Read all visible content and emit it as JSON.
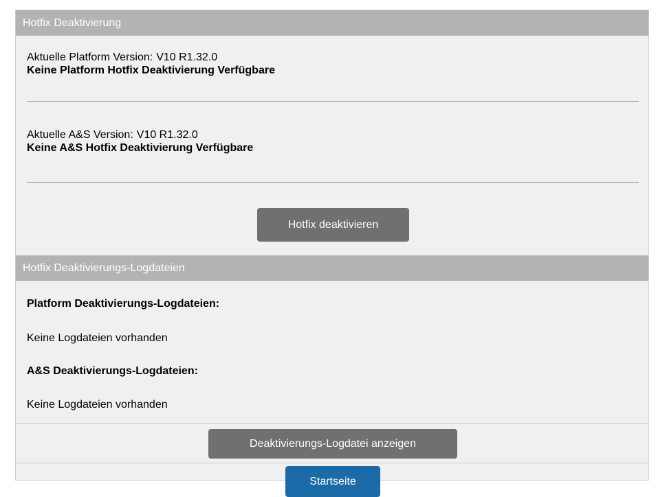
{
  "deactivation": {
    "header": "Hotfix Deaktivierung",
    "platform_label": "Aktuelle Platform Version:",
    "platform_version": "V10 R1.32.0",
    "platform_status": "Keine Platform Hotfix Deaktivierung Verfügbare",
    "as_label": "Aktuelle A&S Version:",
    "as_version": "V10 R1.32.0",
    "as_status": "Keine A&S Hotfix Deaktivierung Verfügbare",
    "deactivate_button": "Hotfix deaktivieren"
  },
  "logs": {
    "header": "Hotfix Deaktivierungs-Logdateien",
    "platform_title": "Platform Deaktivierungs-Logdateien:",
    "platform_empty": "Keine Logdateien vorhanden",
    "as_title": "A&S Deaktivierungs-Logdateien:",
    "as_empty": "Keine Logdateien vorhanden",
    "show_button": "Deaktivierungs-Logdatei anzeigen"
  },
  "footer": {
    "home_button": "Startseite"
  },
  "colors": {
    "header_bg": "#b3b3b3",
    "panel_bg": "#f0f0f0",
    "button_gray": "#707070",
    "button_primary": "#1a6aa8"
  }
}
